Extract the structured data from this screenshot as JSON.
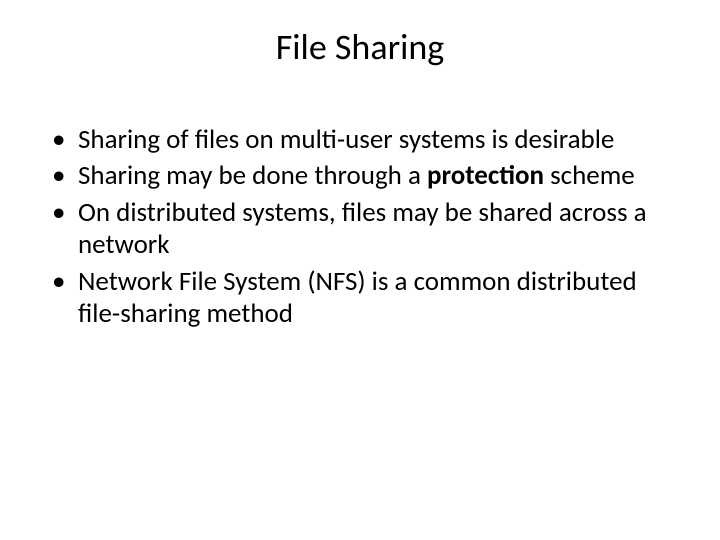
{
  "title": "File Sharing",
  "bullets": [
    {
      "prefix": "Sharing of files on multi-user systems is desirable",
      "bold": "",
      "suffix": ""
    },
    {
      "prefix": "Sharing may be done through a ",
      "bold": "protection",
      "suffix": " scheme"
    },
    {
      "prefix": "On distributed systems, files may be shared across a network",
      "bold": "",
      "suffix": ""
    },
    {
      "prefix": "Network File System (NFS) is a common distributed file-sharing method",
      "bold": "",
      "suffix": ""
    }
  ]
}
